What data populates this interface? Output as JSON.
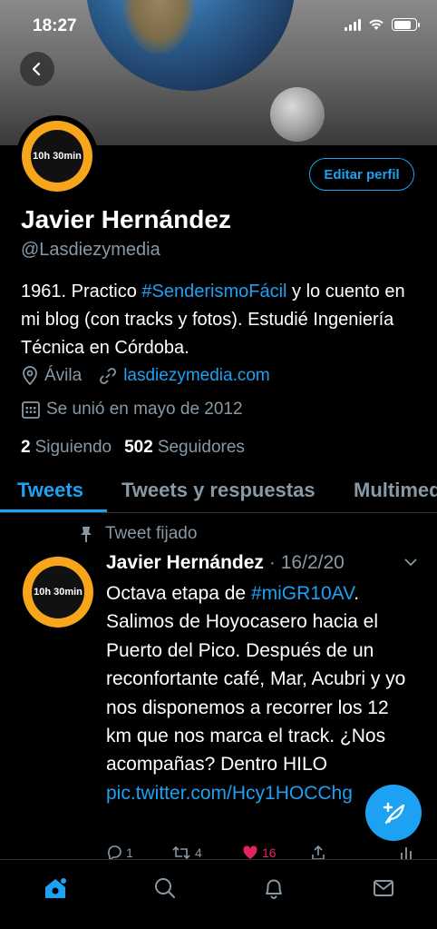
{
  "status_bar": {
    "time": "18:27"
  },
  "profile": {
    "name": "Javier Hernández",
    "handle": "@Lasdiezymedia",
    "edit_button": "Editar perfil",
    "avatar_text": "10h 30min",
    "bio": {
      "part1": "1961. Practico ",
      "hashtag": "#SenderismoFácil",
      "part2": " y lo cuento en mi blog (con tracks y fotos). Estudié Ingeniería Técnica en Córdoba."
    },
    "location": "Ávila",
    "website": "lasdiezymedia.com",
    "joined": "Se unió en mayo de 2012",
    "following_count": "2",
    "following_label": "Siguiendo",
    "followers_count": "502",
    "followers_label": "Seguidores"
  },
  "tabs": [
    {
      "label": "Tweets"
    },
    {
      "label": "Tweets y respuestas"
    },
    {
      "label": "Multimedia"
    }
  ],
  "tweet": {
    "pinned_label": "Tweet fijado",
    "author": "Javier Hernández",
    "date": "· 16/2/20",
    "text_part1": "Octava etapa de ",
    "hashtag": "#miGR10AV",
    "text_part2": ". Salimos de Hoyocasero hacia el Puerto del Pico. Después de un reconfortante café, Mar, Acubri y yo nos disponemos a recorrer los 12 km que nos marca el track. ¿Nos acompañas? Dentro HILO ",
    "link": "pic.twitter.com/Hcy1HOCChg",
    "replies": "1",
    "retweets": "4",
    "likes": "16"
  },
  "colors": {
    "accent": "#1da1f2",
    "like": "#e0245e",
    "muted": "#8899a6",
    "avatar_ring": "#f7a51b"
  },
  "icons": [
    "back-arrow-icon",
    "location-icon",
    "link-icon",
    "calendar-icon",
    "pin-icon",
    "chevron-down-icon",
    "reply-icon",
    "retweet-icon",
    "heart-icon",
    "share-icon",
    "analytics-icon",
    "compose-tweet-icon",
    "home-icon",
    "search-icon",
    "notifications-icon",
    "messages-icon"
  ]
}
